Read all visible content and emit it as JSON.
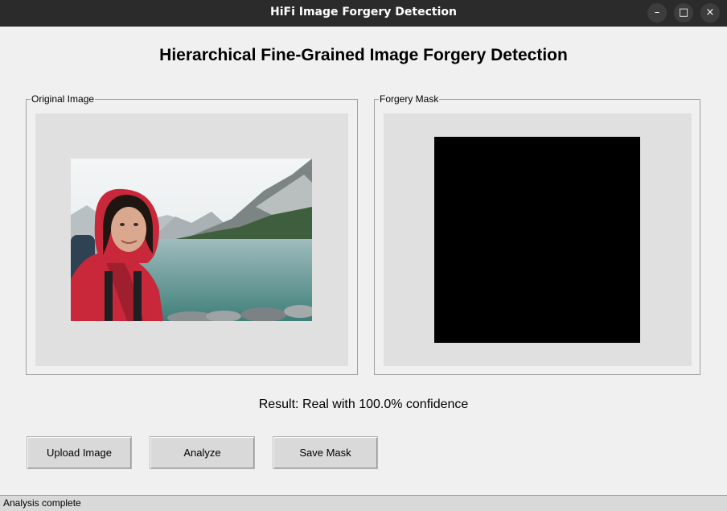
{
  "window": {
    "title": "HiFi Image Forgery Detection",
    "controls": {
      "minimize": "–",
      "maximize": "□",
      "close": "×"
    }
  },
  "heading": "Hierarchical Fine-Grained Image Forgery Detection",
  "panels": {
    "original": {
      "label": "Original Image"
    },
    "mask": {
      "label": "Forgery Mask"
    }
  },
  "result": "Result: Real with 100.0% confidence",
  "buttons": {
    "upload": "Upload Image",
    "analyze": "Analyze",
    "save": "Save Mask"
  },
  "status": "Analysis complete",
  "colors": {
    "titlebar": "#2b2b2b",
    "background": "#f0f0f0",
    "canvas": "#e0e0e0",
    "mask": "#000000"
  }
}
